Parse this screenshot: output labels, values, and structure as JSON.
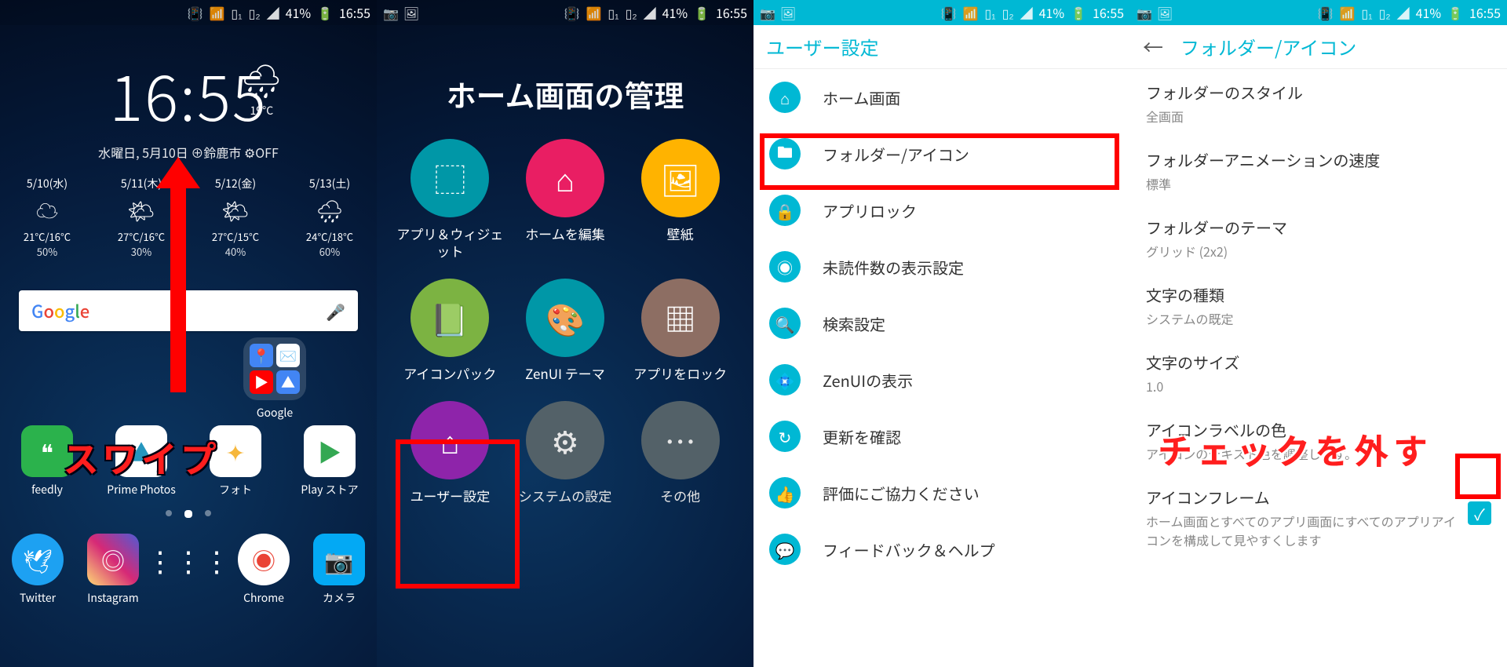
{
  "status": {
    "battery": "41%",
    "time": "16:55"
  },
  "home": {
    "time": "16:55",
    "date": "水曜日, 5月10日  ⊕鈴鹿市  ⚙OFF",
    "today": {
      "temp": "19°C"
    },
    "forecast": [
      {
        "d": "5/10(水)",
        "t": "21°C/16°C",
        "p": "50%"
      },
      {
        "d": "5/11(木)",
        "t": "27°C/16°C",
        "p": "30%"
      },
      {
        "d": "5/12(金)",
        "t": "27°C/15°C",
        "p": "40%"
      },
      {
        "d": "5/13(土)",
        "t": "24°C/18°C",
        "p": "60%"
      }
    ],
    "search_placeholder": "Google",
    "folder_label": "Google",
    "fav": [
      {
        "name": "feedly",
        "color": "#2bb24c",
        "glyph": "❝"
      },
      {
        "name": "Prime Photos",
        "color": "#ffffff",
        "glyph": "▲"
      },
      {
        "name": "フォト",
        "color": "#ffffff",
        "glyph": "✦"
      },
      {
        "name": "Play ストア",
        "color": "#ffffff",
        "glyph": "▶"
      }
    ],
    "dock": [
      {
        "name": "Twitter",
        "color": "#1da1f2",
        "glyph": "🐦"
      },
      {
        "name": "Instagram",
        "color": "#c13584",
        "glyph": "◎"
      },
      {
        "name": "",
        "color": "transparent",
        "glyph": "⋮⋮⋮"
      },
      {
        "name": "Chrome",
        "color": "#ffffff",
        "glyph": "◉"
      },
      {
        "name": "カメラ",
        "color": "#03a9f4",
        "glyph": "📷"
      }
    ],
    "swipe_note": "スワイプ"
  },
  "manage": {
    "title": "ホーム画面の管理",
    "items": [
      {
        "label": "アプリ＆ウィジェット",
        "color": "#0097a7",
        "glyph": "➕"
      },
      {
        "label": "ホームを編集",
        "color": "#e91e63",
        "glyph": "✎"
      },
      {
        "label": "壁紙",
        "color": "#ffb300",
        "glyph": "🖼"
      },
      {
        "label": "アイコンパック",
        "color": "#7cb342",
        "glyph": "📗"
      },
      {
        "label": "ZenUI テーマ",
        "color": "#0097a7",
        "glyph": "🎨"
      },
      {
        "label": "アプリをロック",
        "color": "#8d6e63",
        "glyph": "▦"
      },
      {
        "label": "ユーザー設定",
        "color": "#8e24aa",
        "glyph": "⚙"
      },
      {
        "label": "システムの設定",
        "color": "#546e7a",
        "glyph": "⚙"
      },
      {
        "label": "その他",
        "color": "#546e7a",
        "glyph": "⋯"
      }
    ]
  },
  "settings3": {
    "title": "ユーザー設定",
    "items": [
      {
        "icon": "⌂",
        "label": "ホーム画面"
      },
      {
        "icon": "🖿",
        "label": "フォルダー/アイコン"
      },
      {
        "icon": "🔒",
        "label": "アプリロック"
      },
      {
        "icon": "◉",
        "label": "未読件数の表示設定"
      },
      {
        "icon": "🔍",
        "label": "検索設定"
      },
      {
        "icon": "💠",
        "label": "ZenUIの表示"
      },
      {
        "icon": "↻",
        "label": "更新を確認"
      },
      {
        "icon": "👍",
        "label": "評価にご協力ください"
      },
      {
        "icon": "💬",
        "label": "フィードバック＆ヘルプ"
      }
    ]
  },
  "settings4": {
    "title": "フォルダー/アイコン",
    "prefs": [
      {
        "t": "フォルダーのスタイル",
        "v": "全画面"
      },
      {
        "t": "フォルダーアニメーションの速度",
        "v": "標準"
      },
      {
        "t": "フォルダーのテーマ",
        "v": "グリッド (2x2)"
      },
      {
        "t": "文字の種類",
        "v": "システムの既定"
      },
      {
        "t": "文字のサイズ",
        "v": "1.0"
      },
      {
        "t": "アイコンラベルの色",
        "v": "アイコンのテキスト色を調整します。"
      },
      {
        "t": "アイコンフレーム",
        "v": "ホーム画面とすべてのアプリ画面にすべてのアプリアイコンを構成して見やすくします"
      }
    ],
    "uncheck_note": "チェックを外す"
  }
}
